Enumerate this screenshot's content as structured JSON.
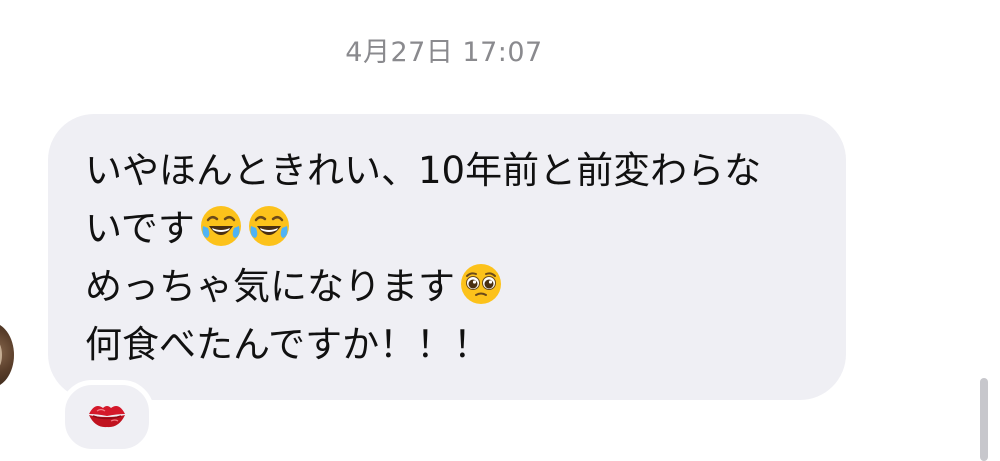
{
  "thread": {
    "timestamp": "4月27日 17:07"
  },
  "message": {
    "lines": [
      "いやほんときれい、10年前と前変わらな",
      "いです",
      "めっちゃ気になります",
      "何食べたんですか！！！"
    ],
    "emoji": {
      "line2": [
        "face-with-tears-of-joy",
        "face-with-tears-of-joy"
      ],
      "line3": [
        "pleading-face"
      ]
    },
    "reaction": "kiss-mark"
  }
}
